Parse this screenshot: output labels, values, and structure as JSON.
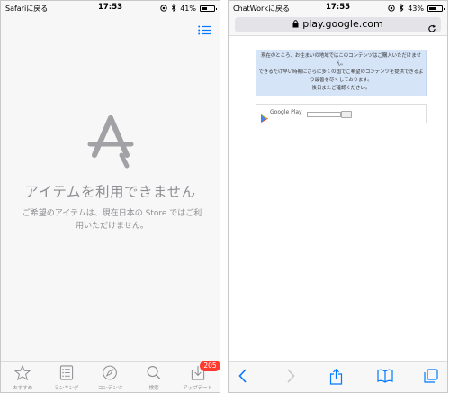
{
  "left": {
    "status": {
      "back": "Safariに戻る",
      "time": "17:53",
      "battery": "41%"
    },
    "title": "アイテムを利用できません",
    "subtitle": "ご希望のアイテムは、現在日本の Store ではご利用いただけません。",
    "tabs": [
      {
        "label": "おすすめ",
        "icon": "star-icon"
      },
      {
        "label": "ランキング",
        "icon": "list-icon"
      },
      {
        "label": "コンテンツ",
        "icon": "compass-icon"
      },
      {
        "label": "検索",
        "icon": "search-icon"
      },
      {
        "label": "アップデート",
        "icon": "download-icon",
        "badge": "205"
      }
    ]
  },
  "right": {
    "status": {
      "back": "ChatWorkに戻る",
      "time": "17:55",
      "battery": "43%"
    },
    "url": "play.google.com",
    "notice": [
      "現在のところ、お住まいの地域ではこのコンテンツはご購入いただけません。",
      "できるだけ早い時期にさらに多くの国でご希望のコンテンツを提供できるよう最善を尽くしております。",
      "後日またご確認ください。"
    ],
    "google_play_label": "Google Play"
  },
  "colors": {
    "accent": "#007aff",
    "gray": "#8e8e93",
    "badge": "#ff3b30",
    "notice_bg": "#d6e4f7"
  }
}
